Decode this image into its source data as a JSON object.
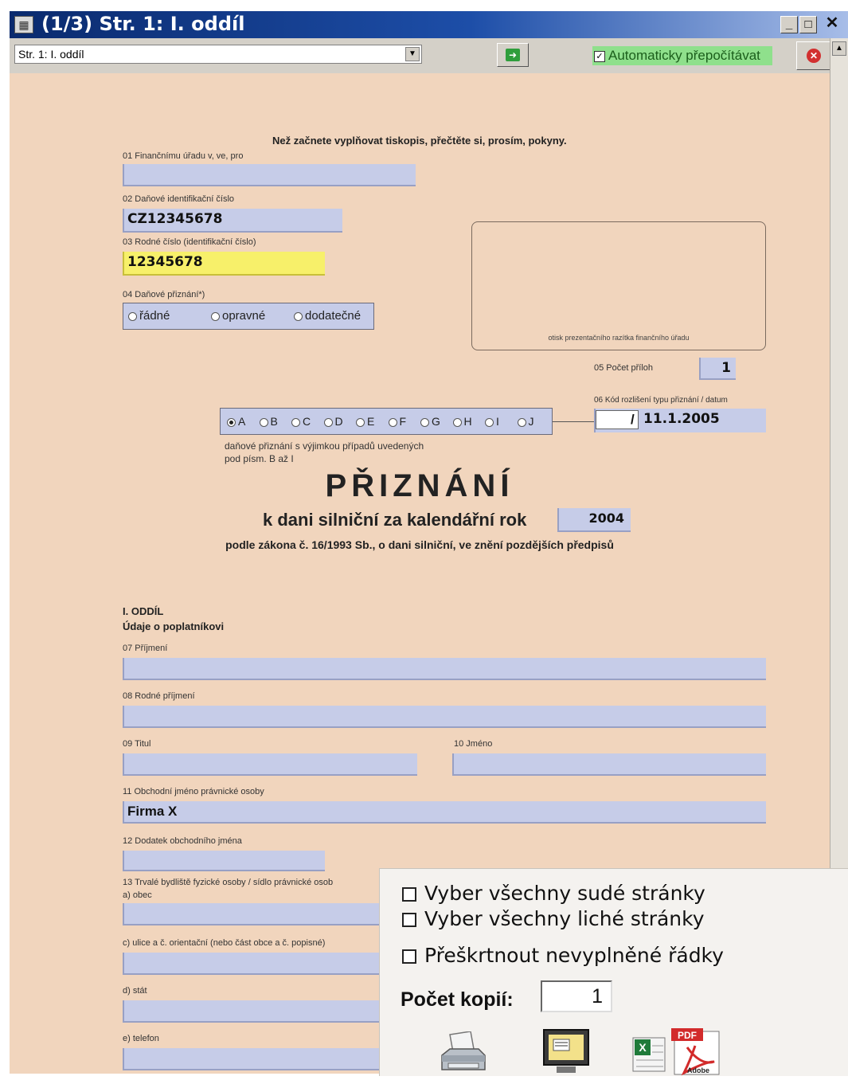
{
  "window": {
    "title": "(1/3) Str. 1: I. oddíl",
    "controls": [
      "_",
      "□",
      "✕"
    ]
  },
  "toolbar": {
    "page_select_value": "Str. 1: I. oddíl",
    "auto_recalc_label": "Automaticky přepočítávat",
    "auto_recalc_checked": true
  },
  "form": {
    "notice": "Než začnete vyplňovat tiskopis, přečtěte si, prosím, pokyny.",
    "f01_label": "01 Finančnímu úřadu v, ve, pro",
    "f01_value": "",
    "f02_label": "02 Daňové identifikační číslo",
    "f02_value": "CZ12345678",
    "f03_label": "03 Rodné číslo (identifikační číslo)",
    "f03_value": "12345678",
    "f04_label": "04 Daňové přiznání*)",
    "f04_options": [
      "řádné",
      "opravné",
      "dodatečné"
    ],
    "stamp_label": "otisk prezentačního razítka finančního úřadu",
    "f05_label": "05 Počet příloh",
    "f05_value": "1",
    "f06_label": "06 Kód rozlišení typu přiznání / datum",
    "f06_code": "",
    "f06_sep": "/",
    "f06_date": "11.1.2005",
    "type_options": [
      "A",
      "B",
      "C",
      "D",
      "E",
      "F",
      "G",
      "H",
      "I",
      "J"
    ],
    "type_selected": "A",
    "type_note_1": "daňové přiznání s výjimkou případů uvedených",
    "type_note_2": "pod písm. B až I",
    "heading": "PŘIZNÁNÍ",
    "subheading": "k dani silniční za kalendářní rok",
    "year": "2004",
    "law": "podle zákona č. 16/1993 Sb., o dani silniční, ve znění pozdějších předpisů",
    "section_title": "I. ODDÍL",
    "section_sub": "Údaje o poplatníkovi",
    "f07_label": "07 Příjmení",
    "f08_label": "08 Rodné příjmení",
    "f09_label": "09 Titul",
    "f10_label": "10 Jméno",
    "f11_label": "11 Obchodní jméno právnické osoby",
    "f11_value": "Firma X",
    "f12_label": "12 Dodatek obchodního jména",
    "f13_label": "13 Trvalé bydliště fyzické osoby / sídlo právnické osob",
    "f13a_label": "a) obec",
    "f13c_label": "c) ulice a č. orientační (nebo část obce a č. popisné)",
    "f13d_label": "d) stát",
    "f13e_label": "e) telefon"
  },
  "print_panel": {
    "even_pages": "Vyber všechny sudé stránky",
    "odd_pages": "Vyber všechny liché stránky",
    "strike_empty": "Přeškrtnout nevyplněné řádky",
    "copies_label": "Počet kopií:",
    "copies_value": "1",
    "pdf_badge": "PDF",
    "adobe_text": "Adobe"
  },
  "colors": {
    "form_bg": "#f1d5bd",
    "field_bg": "#c6cce8",
    "highlight_field": "#f7f06a",
    "titlebar": "#1d4ea8",
    "auto_recalc_bg": "#8fe08c"
  }
}
